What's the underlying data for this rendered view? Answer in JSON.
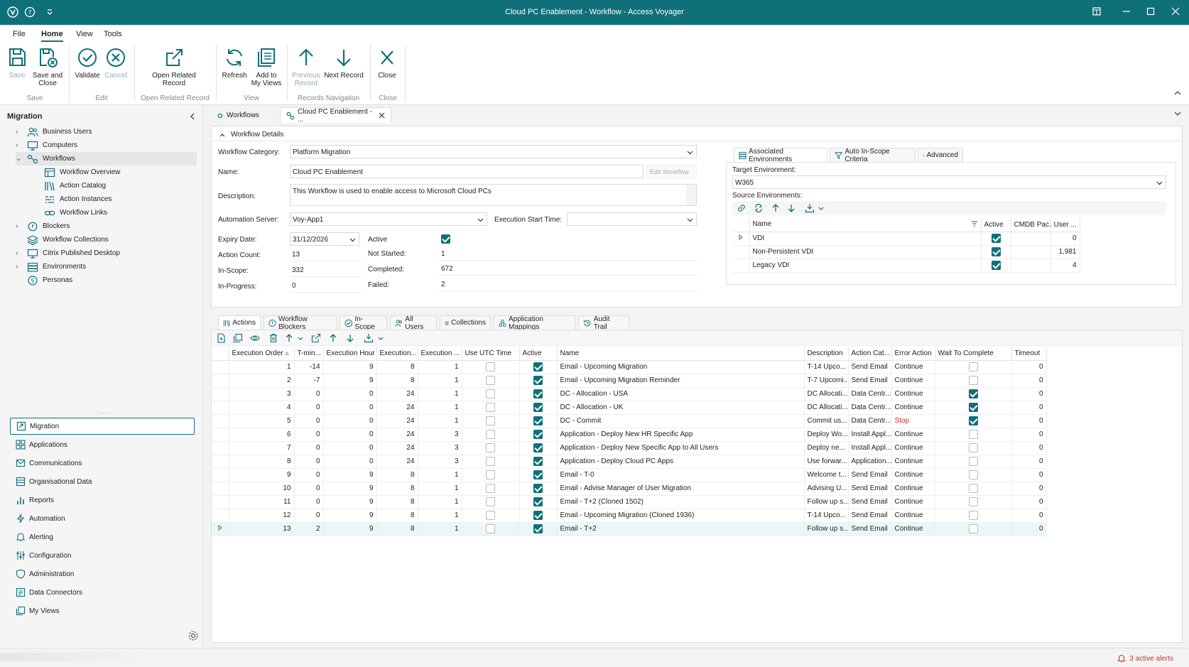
{
  "window": {
    "title": "Cloud PC Enablement - Workflow - Access Voyager"
  },
  "menu": {
    "items": [
      "File",
      "Home",
      "View",
      "Tools"
    ],
    "active": "Home"
  },
  "ribbon": {
    "save": "Save",
    "save_close": [
      "Save and",
      "Close"
    ],
    "validate": "Validate",
    "cancel": "Cancel",
    "open_related": [
      "Open Related",
      "Record"
    ],
    "refresh": "Refresh",
    "add_views": [
      "Add to",
      "My Views"
    ],
    "prev_record": [
      "Previous",
      "Record"
    ],
    "next_record": "Next Record",
    "close": "Close",
    "groups": {
      "save": "Save",
      "edit": "Edit",
      "open_related": "Open Related Record",
      "view": "View",
      "nav": "Records Navigation",
      "close": "Close"
    }
  },
  "sidebar": {
    "header": "Migration",
    "tree": [
      {
        "label": "Business Users",
        "icon": "users-icon"
      },
      {
        "label": "Computers",
        "icon": "monitor-icon"
      },
      {
        "label": "Workflows",
        "icon": "workflow-icon"
      },
      {
        "label": "Workflow Overview",
        "icon": "overview-icon"
      },
      {
        "label": "Action Catalog",
        "icon": "catalog-icon"
      },
      {
        "label": "Action Instances",
        "icon": "instances-icon"
      },
      {
        "label": "Workflow Links",
        "icon": "link-icon"
      },
      {
        "label": "Blockers",
        "icon": "blocker-icon"
      },
      {
        "label": "Workflow Collections",
        "icon": "collection-icon"
      },
      {
        "label": "Citrix Published Desktop",
        "icon": "desktop-icon"
      },
      {
        "label": "Environments",
        "icon": "environment-icon"
      },
      {
        "label": "Personas",
        "icon": "persona-icon"
      }
    ],
    "nav": [
      {
        "label": "Migration",
        "icon": "migration-icon"
      },
      {
        "label": "Applications",
        "icon": "applications-icon"
      },
      {
        "label": "Communications",
        "icon": "communications-icon"
      },
      {
        "label": "Organisational Data",
        "icon": "org-data-icon"
      },
      {
        "label": "Reports",
        "icon": "reports-icon"
      },
      {
        "label": "Automation",
        "icon": "automation-icon"
      },
      {
        "label": "Alerting",
        "icon": "alerting-icon"
      },
      {
        "label": "Configuration",
        "icon": "configuration-icon"
      },
      {
        "label": "Administration",
        "icon": "administration-icon"
      },
      {
        "label": "Data Connectors",
        "icon": "data-connectors-icon"
      },
      {
        "label": "My Views",
        "icon": "my-views-icon"
      }
    ]
  },
  "doctabs": {
    "workflows": "Workflows",
    "current": "Cloud PC Enablement - ..."
  },
  "details": {
    "section_title": "Workflow Details",
    "category_label": "Workflow Category:",
    "category_value": "Platform Migration",
    "name_label": "Name:",
    "name_value": "Cloud PC Enablement",
    "edit_workflow": "Edit Workflow",
    "description_label": "Description:",
    "description_value": "This Workflow is used to enable access to Microsoft Cloud PCs",
    "automation_label": "Automation Server:",
    "automation_value": "Voy-App1",
    "exec_start_label": "Execution Start Time:",
    "exec_start_value": "",
    "expiry_label": "Expiry Date:",
    "expiry_value": "31/12/2026",
    "active_label": "Active",
    "action_count_label": "Action Count:",
    "action_count_value": "13",
    "not_started_label": "Not Started:",
    "not_started_value": "1",
    "in_scope_label": "In-Scope:",
    "in_scope_value": "332",
    "completed_label": "Completed:",
    "completed_value": "672",
    "in_progress_label": "In-Progress:",
    "in_progress_value": "0",
    "failed_label": "Failed:",
    "failed_value": "2"
  },
  "env": {
    "tabs": [
      "Associated Environments",
      "Auto In-Scope Criteria",
      "Advanced"
    ],
    "target_label": "Target Environment:",
    "target_value": "W365",
    "source_label": "Source Environments:",
    "columns": [
      "Name",
      "Active",
      "CMDB Pac...",
      "User ..."
    ],
    "rows": [
      {
        "name": "VDI",
        "active": true,
        "cmdb": "",
        "users": "0"
      },
      {
        "name": "Non-Persistent VDI",
        "active": true,
        "cmdb": "",
        "users": "1,981"
      },
      {
        "name": "Legacy VDI",
        "active": true,
        "cmdb": "",
        "users": "4"
      }
    ]
  },
  "action_tabs": [
    "Actions",
    "Workflow Blockers",
    "In-Scope",
    "All Users",
    "Collections",
    "Application Mappings",
    "Audit Trail"
  ],
  "actions": {
    "columns": [
      "Execution Order",
      "T-min...",
      "Execution Hour",
      "Execution...",
      "Execution ...",
      "Use UTC Time",
      "Active",
      "Name",
      "Description",
      "Action Cat...",
      "Error Action",
      "Wait To Complete",
      "Timeout"
    ],
    "rows": [
      [
        "1",
        "-14",
        "9",
        "8",
        "1",
        false,
        true,
        "Email - Upcoming Migration",
        "T-14 Upco...",
        "Send Email",
        "Continue",
        false,
        "0"
      ],
      [
        "2",
        "-7",
        "9",
        "8",
        "1",
        false,
        true,
        "Email - Upcoming Migration Reminder",
        "T-7 Upcomi...",
        "Send Email",
        "Continue",
        false,
        "0"
      ],
      [
        "3",
        "0",
        "0",
        "24",
        "1",
        false,
        true,
        "DC - Allocation - USA",
        "DC Allocati...",
        "Data Centr...",
        "Continue",
        true,
        "0"
      ],
      [
        "4",
        "0",
        "0",
        "24",
        "1",
        false,
        true,
        "DC - Allocation - UK",
        "DC Allocati...",
        "Data Centr...",
        "Continue",
        true,
        "0"
      ],
      [
        "5",
        "0",
        "0",
        "24",
        "1",
        false,
        true,
        "DC - Commit",
        "Commit us...",
        "Data Centr...",
        "Stop",
        true,
        "0"
      ],
      [
        "6",
        "0",
        "0",
        "24",
        "3",
        false,
        true,
        "Application - Deploy New HR Specific App",
        "Deploy Wo...",
        "Install Appl...",
        "Continue",
        false,
        "0"
      ],
      [
        "7",
        "0",
        "0",
        "24",
        "3",
        false,
        true,
        "Application - Deploy New Specific App to All Users",
        "Deploy ne...",
        "Install Appl...",
        "Continue",
        false,
        "0"
      ],
      [
        "8",
        "0",
        "0",
        "24",
        "3",
        false,
        true,
        "Application - Deploy Cloud PC Apps",
        "Use forwar...",
        "Application...",
        "Continue",
        false,
        "0"
      ],
      [
        "9",
        "0",
        "9",
        "8",
        "1",
        false,
        true,
        "Email - T-0",
        "Welcome t...",
        "Send Email",
        "Continue",
        false,
        "0"
      ],
      [
        "10",
        "0",
        "9",
        "8",
        "1",
        false,
        true,
        "Email - Advise Manager of User Migration",
        "Advising U...",
        "Send Email",
        "Continue",
        false,
        "0"
      ],
      [
        "11",
        "0",
        "9",
        "8",
        "1",
        false,
        true,
        "Email - T+2 (Cloned 1502)",
        "Follow up s...",
        "Send Email",
        "Continue",
        false,
        "0"
      ],
      [
        "12",
        "0",
        "9",
        "8",
        "1",
        false,
        true,
        "Email - Upcoming Migration (Cloned 1936)",
        "T-14 Upco...",
        "Send Email",
        "Continue",
        false,
        "0"
      ],
      [
        "13",
        "2",
        "9",
        "8",
        "1",
        false,
        true,
        "Email - T+2",
        "Follow up s...",
        "Send Email",
        "Continue",
        false,
        "0"
      ]
    ]
  },
  "status": {
    "alerts": "3 active alerts"
  },
  "colors": {
    "accent": "#10707a",
    "stop": "#d9261c"
  }
}
